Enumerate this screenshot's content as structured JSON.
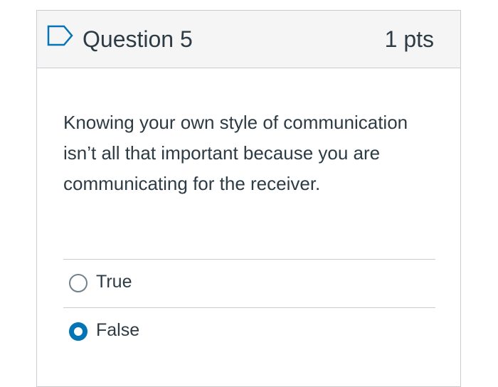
{
  "question": {
    "title": "Question 5",
    "points": "1 pts",
    "text": "Knowing your own style of communication isn’t all that important because you are communicating for the receiver.",
    "flag_icon": "flag-outline-icon"
  },
  "answers": [
    {
      "label": "True",
      "selected": false
    },
    {
      "label": "False",
      "selected": true
    }
  ],
  "colors": {
    "accent": "#0374b5",
    "text": "#2d3b45",
    "border": "#c7cdd1",
    "header_bg": "#f5f5f5"
  }
}
